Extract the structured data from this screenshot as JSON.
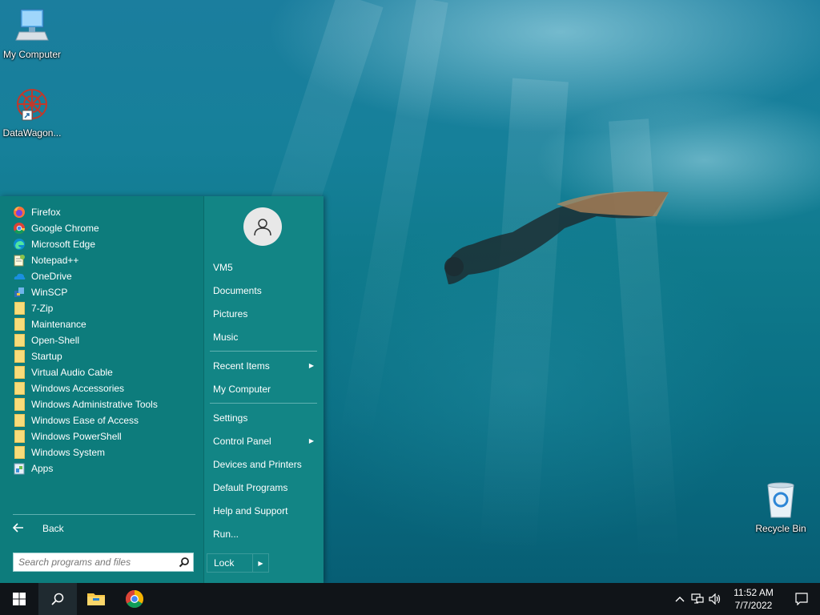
{
  "desktop": {
    "icons": [
      {
        "label": "My Computer",
        "icon": "computer-icon"
      },
      {
        "label": "DataWagon...",
        "icon": "datawagon-icon"
      },
      {
        "label": "Recycle Bin",
        "icon": "recycle-bin-icon"
      }
    ]
  },
  "start_menu": {
    "programs": [
      {
        "label": "Firefox",
        "icon": "firefox-icon"
      },
      {
        "label": "Google Chrome",
        "icon": "chrome-icon"
      },
      {
        "label": "Microsoft Edge",
        "icon": "edge-icon"
      },
      {
        "label": "Notepad++",
        "icon": "notepadpp-icon"
      },
      {
        "label": "OneDrive",
        "icon": "onedrive-icon"
      },
      {
        "label": "WinSCP",
        "icon": "winscp-icon"
      },
      {
        "label": "7-Zip",
        "icon": "folder-icon"
      },
      {
        "label": "Maintenance",
        "icon": "folder-icon"
      },
      {
        "label": "Open-Shell",
        "icon": "folder-icon"
      },
      {
        "label": "Startup",
        "icon": "folder-icon"
      },
      {
        "label": "Virtual Audio Cable",
        "icon": "folder-icon"
      },
      {
        "label": "Windows Accessories",
        "icon": "folder-icon"
      },
      {
        "label": "Windows Administrative Tools",
        "icon": "folder-icon"
      },
      {
        "label": "Windows Ease of Access",
        "icon": "folder-icon"
      },
      {
        "label": "Windows PowerShell",
        "icon": "folder-icon"
      },
      {
        "label": "Windows System",
        "icon": "folder-icon"
      },
      {
        "label": "Apps",
        "icon": "apps-icon"
      }
    ],
    "back_label": "Back",
    "search_placeholder": "Search programs and files",
    "user_name": "VM5",
    "right_group1": [
      "VM5",
      "Documents",
      "Pictures",
      "Music"
    ],
    "right_group2": [
      {
        "label": "Recent Items",
        "submenu": true
      },
      {
        "label": "My Computer",
        "submenu": false
      }
    ],
    "right_group3": [
      {
        "label": "Settings",
        "submenu": false
      },
      {
        "label": "Control Panel",
        "submenu": true
      },
      {
        "label": "Devices and Printers",
        "submenu": false
      },
      {
        "label": "Default Programs",
        "submenu": false
      },
      {
        "label": "Help and Support",
        "submenu": false
      },
      {
        "label": "Run...",
        "submenu": false
      }
    ],
    "lock_label": "Lock"
  },
  "taskbar": {
    "pinned": [
      "start-icon",
      "search-icon",
      "file-explorer-icon",
      "chrome-icon"
    ],
    "clock_time": "11:52 AM",
    "clock_date": "7/7/2022"
  },
  "colors": {
    "menu_bg": "#0d7c7c",
    "taskbar_bg": "#101418"
  }
}
